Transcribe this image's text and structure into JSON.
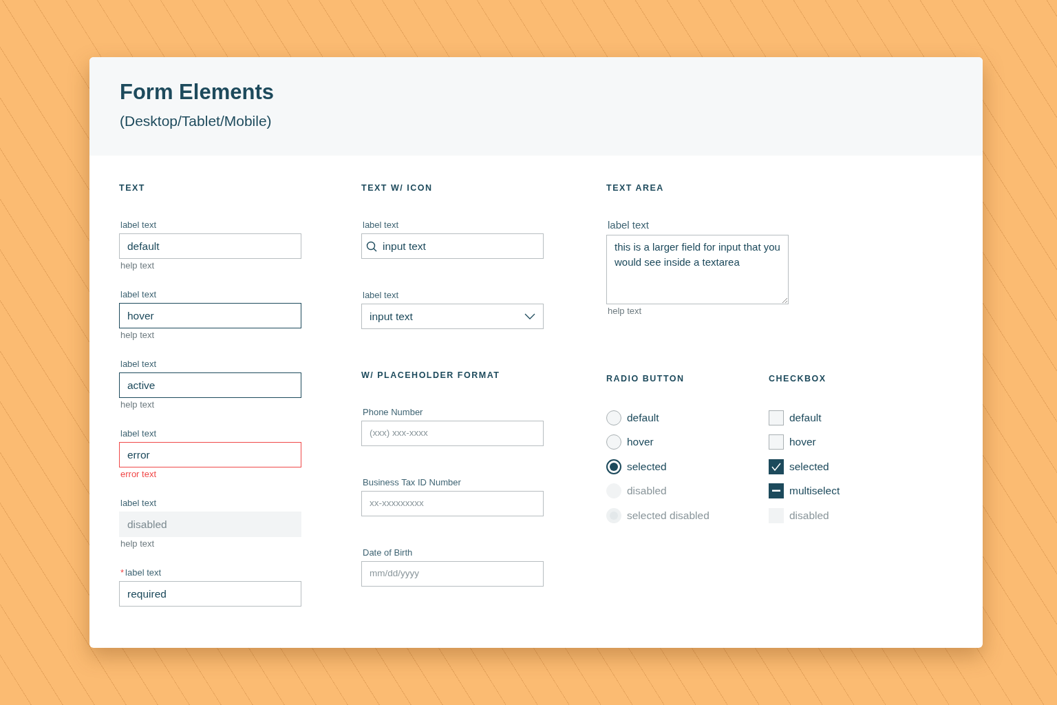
{
  "header": {
    "title": "Form Elements",
    "subtitle": "(Desktop/Tablet/Mobile)"
  },
  "text": {
    "heading": "TEXT",
    "fields": [
      {
        "label": "label text",
        "value": "default",
        "kind": "plain",
        "note": "help text"
      },
      {
        "label": "label text",
        "value": "hover",
        "kind": "hover",
        "note": "help text"
      },
      {
        "label": "label text",
        "value": "active",
        "kind": "active",
        "note": "help text"
      },
      {
        "label": "label text",
        "value": "error",
        "kind": "error",
        "note": "error text"
      },
      {
        "label": "label text",
        "value": "disabled",
        "kind": "disabled",
        "note": "help text"
      },
      {
        "label": "label text",
        "value": "required",
        "kind": "plain",
        "required_mark": "*"
      }
    ]
  },
  "text_with_icon": {
    "heading": "TEXT W/ ICON",
    "fields": [
      {
        "kind": "search",
        "label": "label text",
        "value": "input text"
      },
      {
        "kind": "select",
        "label": "label text",
        "value": "input text"
      }
    ]
  },
  "placeholder_format": {
    "heading": "W/ PLACEHOLDER FORMAT",
    "fields": [
      {
        "label": "Phone Number",
        "placeholder": "(xxx) xxx-xxxx"
      },
      {
        "label": "Business Tax ID Number",
        "placeholder": "xx-xxxxxxxxx"
      },
      {
        "label": "Date of Birth",
        "placeholder": "mm/dd/yyyy"
      }
    ]
  },
  "text_area": {
    "heading": "TEXT AREA",
    "label": "label text",
    "value": "this is a larger field for input that you would see inside a textarea",
    "note": "help text"
  },
  "radio": {
    "heading": "RADIO BUTTON",
    "items": [
      {
        "label": "default",
        "selected": false,
        "disabled": false
      },
      {
        "label": "hover",
        "selected": false,
        "disabled": false
      },
      {
        "label": "selected",
        "selected": true,
        "disabled": false
      },
      {
        "label": "disabled",
        "selected": false,
        "disabled": true
      },
      {
        "label": "selected disabled",
        "selected": true,
        "disabled": true
      }
    ]
  },
  "checkbox": {
    "heading": "CHECKBOX",
    "items": [
      {
        "label": "default",
        "checked": false,
        "indeterminate": false,
        "disabled": false
      },
      {
        "label": "hover",
        "checked": false,
        "indeterminate": false,
        "disabled": false
      },
      {
        "label": "selected",
        "checked": true,
        "indeterminate": false,
        "disabled": false
      },
      {
        "label": "multiselect",
        "checked": true,
        "indeterminate": true,
        "disabled": false
      },
      {
        "label": "disabled",
        "checked": false,
        "indeterminate": false,
        "disabled": true
      }
    ]
  }
}
